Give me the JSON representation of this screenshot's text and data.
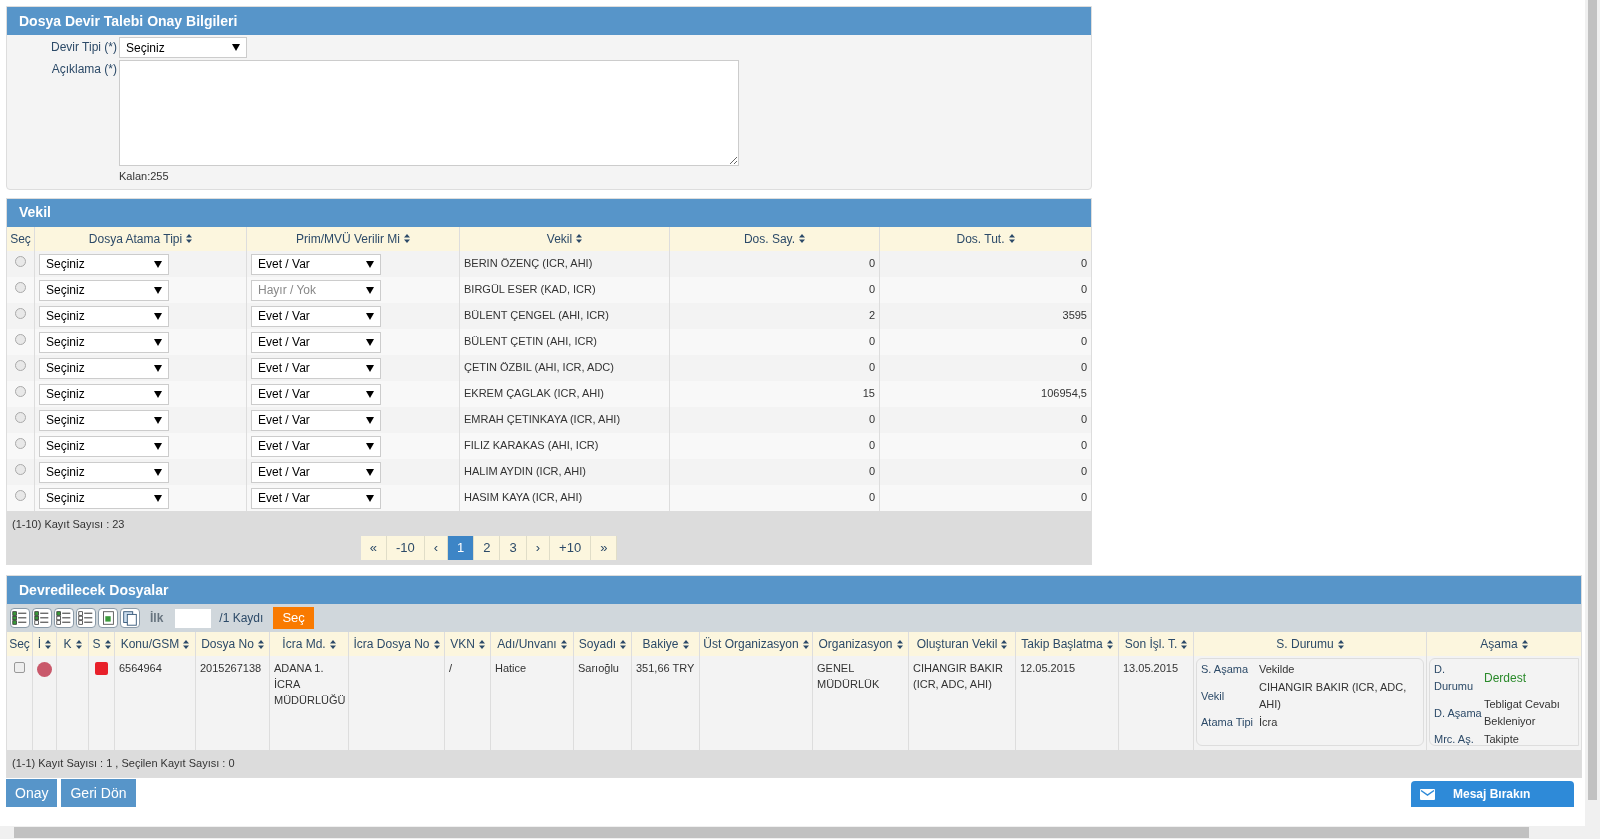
{
  "transfer_panel": {
    "title": "Dosya Devir Talebi Onay Bilgileri",
    "type_label": "Devir Tipi (*)",
    "type_value": "Seçiniz",
    "note_label": "Açıklama (*)",
    "remaining": "Kalan:255"
  },
  "lawyers": {
    "title": "Vekil",
    "columns": [
      "Seç",
      "Dosya Atama Tipi",
      "Prim/MVÜ Verilir Mi",
      "Vekil",
      "Dos. Say.",
      "Dos. Tut."
    ],
    "rows": [
      {
        "selected": false,
        "assignment": "Seçiniz",
        "bonus": "Evet / Var",
        "bonus_muted": false,
        "name": "BERIN ÖZENÇ (ICR, AHI)",
        "count": "0",
        "amount": "0"
      },
      {
        "selected": false,
        "assignment": "Seçiniz",
        "bonus": "Hayır / Yok",
        "bonus_muted": true,
        "name": "BIRGÜL ESER (KAD, ICR)",
        "count": "0",
        "amount": "0"
      },
      {
        "selected": false,
        "assignment": "Seçiniz",
        "bonus": "Evet / Var",
        "bonus_muted": false,
        "name": "BÜLENT ÇENGEL (AHI, ICR)",
        "count": "2",
        "amount": "3595"
      },
      {
        "selected": false,
        "assignment": "Seçiniz",
        "bonus": "Evet / Var",
        "bonus_muted": false,
        "name": "BÜLENT ÇETIN (AHI, ICR)",
        "count": "0",
        "amount": "0"
      },
      {
        "selected": false,
        "assignment": "Seçiniz",
        "bonus": "Evet / Var",
        "bonus_muted": false,
        "name": "ÇETIN ÖZBIL (AHI, ICR, ADC)",
        "count": "0",
        "amount": "0"
      },
      {
        "selected": false,
        "assignment": "Seçiniz",
        "bonus": "Evet / Var",
        "bonus_muted": false,
        "name": "EKREM ÇAGLAK (ICR, AHI)",
        "count": "15",
        "amount": "106954,5"
      },
      {
        "selected": false,
        "assignment": "Seçiniz",
        "bonus": "Evet / Var",
        "bonus_muted": false,
        "name": "EMRAH ÇETINKAYA (ICR, AHI)",
        "count": "0",
        "amount": "0"
      },
      {
        "selected": false,
        "assignment": "Seçiniz",
        "bonus": "Evet / Var",
        "bonus_muted": false,
        "name": "FILIZ KARAKAS (AHI, ICR)",
        "count": "0",
        "amount": "0"
      },
      {
        "selected": false,
        "assignment": "Seçiniz",
        "bonus": "Evet / Var",
        "bonus_muted": false,
        "name": "HALIM AYDIN (ICR, AHI)",
        "count": "0",
        "amount": "0"
      },
      {
        "selected": false,
        "assignment": "Seçiniz",
        "bonus": "Evet / Var",
        "bonus_muted": false,
        "name": "HASIM KAYA (ICR, AHI)",
        "count": "0",
        "amount": "0"
      }
    ],
    "record_count": "(1-10) Kayıt Sayısı : 23",
    "pagination": [
      {
        "label": "«",
        "selected": false
      },
      {
        "label": "-10",
        "selected": false
      },
      {
        "label": "‹",
        "selected": false
      },
      {
        "label": "1",
        "selected": true
      },
      {
        "label": "2",
        "selected": false
      },
      {
        "label": "3",
        "selected": false
      },
      {
        "label": "›",
        "selected": false
      },
      {
        "label": "+10",
        "selected": false
      },
      {
        "label": "»",
        "selected": false
      }
    ]
  },
  "files": {
    "title": "Devredilecek Dosyalar",
    "first_label": "İlk",
    "page_total": "/1 Kaydı",
    "go_button": "Seç",
    "columns": [
      "Seç",
      "İ",
      "K",
      "S",
      "Konu/GSM",
      "Dosya No",
      "İcra Md.",
      "İcra Dosya No",
      "VKN",
      "Adı/Unvanı",
      "Soyadı",
      "Bakiye",
      "Üst Organizasyon",
      "Organizasyon",
      "Oluşturan Vekil",
      "Takip Başlatma",
      "Son İşl. T.",
      "S. Durumu",
      "Aşama"
    ],
    "rows": [
      {
        "checked": false,
        "i_mark": {
          "color": "#c9596b"
        },
        "s_mark": {
          "color": "#e8202a"
        },
        "subject": "6564964",
        "file_no": "2015267138",
        "office": "ADANA 1. İCRA MÜDÜRLÜĞÜ",
        "vkn": "/",
        "first_name": "Hatice",
        "last_name": "Sarıoğlu",
        "balance": "351,66 TRY",
        "organization": "GENEL MÜDÜRLÜK",
        "creator": "CIHANGIR BAKIR (ICR, ADC, AHI)",
        "start_date": "12.05.2015",
        "last_date": "13.05.2015",
        "status": [
          {
            "label": "S. Aşama",
            "value": "Vekilde"
          },
          {
            "label": "Vekil",
            "value": "CIHANGIR BAKIR (ICR, ADC, AHI)"
          },
          {
            "label": "Atama Tipi",
            "value": "İcra"
          }
        ],
        "stage": [
          {
            "label": "D. Durumu",
            "value": "Derdest",
            "highlight": true
          },
          {
            "label": "D. Aşama",
            "value": "Tebligat Cevabı Bekleniyor",
            "highlight": false
          },
          {
            "label": "Mrc. Aş.",
            "value": "Takipte",
            "highlight": false
          }
        ]
      }
    ],
    "footer": "(1-1) Kayıt Sayısı : 1 , Seçilen Kayıt Sayısı : 0"
  },
  "buttons": [
    "Onay",
    "Geri Dön"
  ],
  "message_button": "Mesaj Bırakın"
}
